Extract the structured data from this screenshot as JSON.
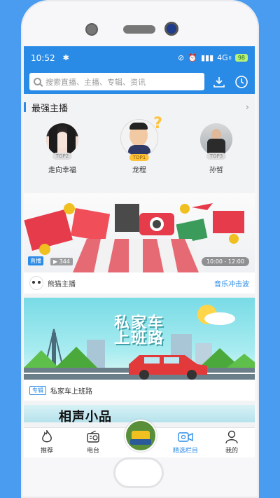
{
  "status": {
    "time": "10:52",
    "network": "4G",
    "signal_sub": "II",
    "battery": "98"
  },
  "search": {
    "placeholder": "搜索直播、主播、专辑、资讯"
  },
  "top_anchors": {
    "title": "最强主播",
    "more": "›",
    "items": [
      {
        "name": "走向幸福",
        "rank": "TOP2"
      },
      {
        "name": "龙程",
        "rank": "TOP1"
      },
      {
        "name": "孙哲",
        "rank": "TOP3"
      }
    ]
  },
  "live_card": {
    "tag": "直播",
    "viewers": "▶ 344",
    "time": "10:00 - 12:00",
    "host": "熊猫主播",
    "program": "音乐冲击波"
  },
  "album_card": {
    "banner_title_1": "私家车",
    "banner_title_2": "上班路",
    "tag": "专辑",
    "title": "私家车上班路"
  },
  "next_card": {
    "banner_title": "相声小品"
  },
  "tabbar": {
    "items": [
      {
        "label": "推荐",
        "icon": "flame-icon"
      },
      {
        "label": "电台",
        "icon": "radio-icon"
      },
      {
        "label": "",
        "icon": "center-logo"
      },
      {
        "label": "精选栏目",
        "icon": "video-camera-icon"
      },
      {
        "label": "我的",
        "icon": "person-icon"
      }
    ]
  },
  "colors": {
    "accent": "#2a8be6",
    "background": "#4a9cf0"
  }
}
